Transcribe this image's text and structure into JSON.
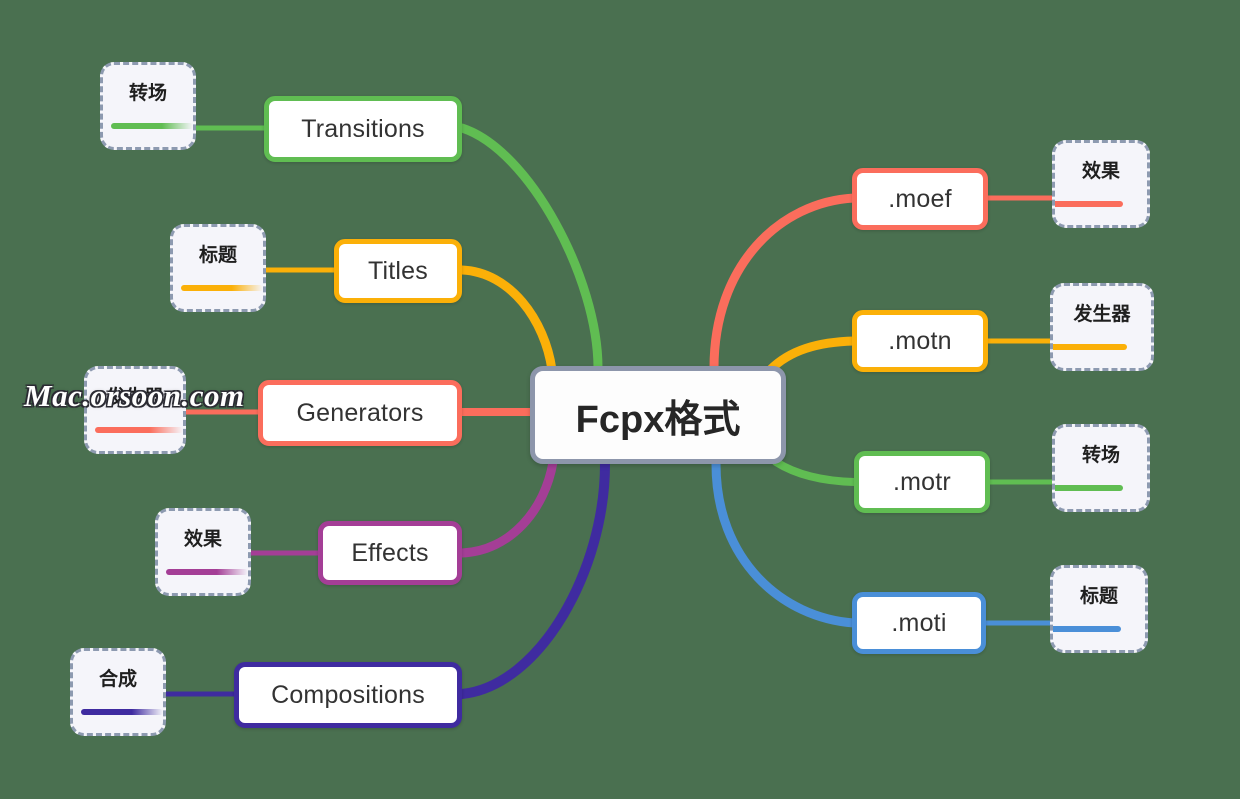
{
  "diagram": {
    "title": "Fcpx格式",
    "background_color": "#4a7050",
    "root": {
      "label": "Fcpx格式",
      "border_color": "#8d96ab"
    },
    "watermark": {
      "text": "Mac.orsoon.com"
    },
    "left_branches": [
      {
        "label": "Transitions",
        "color": "#60bd52",
        "leaf": {
          "label": "转场"
        }
      },
      {
        "label": "Titles",
        "color": "#fbb008",
        "leaf": {
          "label": "标题"
        }
      },
      {
        "label": "Generators",
        "color": "#fb6d5c",
        "leaf": {
          "label": "发生器"
        }
      },
      {
        "label": "Effects",
        "color": "#a43e96",
        "leaf": {
          "label": "效果"
        }
      },
      {
        "label": "Compositions",
        "color": "#3f2ba0",
        "leaf": {
          "label": "合成"
        }
      }
    ],
    "right_branches": [
      {
        "label": ".moef",
        "color": "#fb6d5c",
        "leaf": {
          "label": "效果"
        }
      },
      {
        "label": ".motn",
        "color": "#fbb008",
        "leaf": {
          "label": "发生器"
        }
      },
      {
        "label": ".motr",
        "color": "#60bd52",
        "leaf": {
          "label": "转场"
        }
      },
      {
        "label": ".moti",
        "color": "#4a8fd8",
        "leaf": {
          "label": "标题"
        }
      }
    ]
  }
}
